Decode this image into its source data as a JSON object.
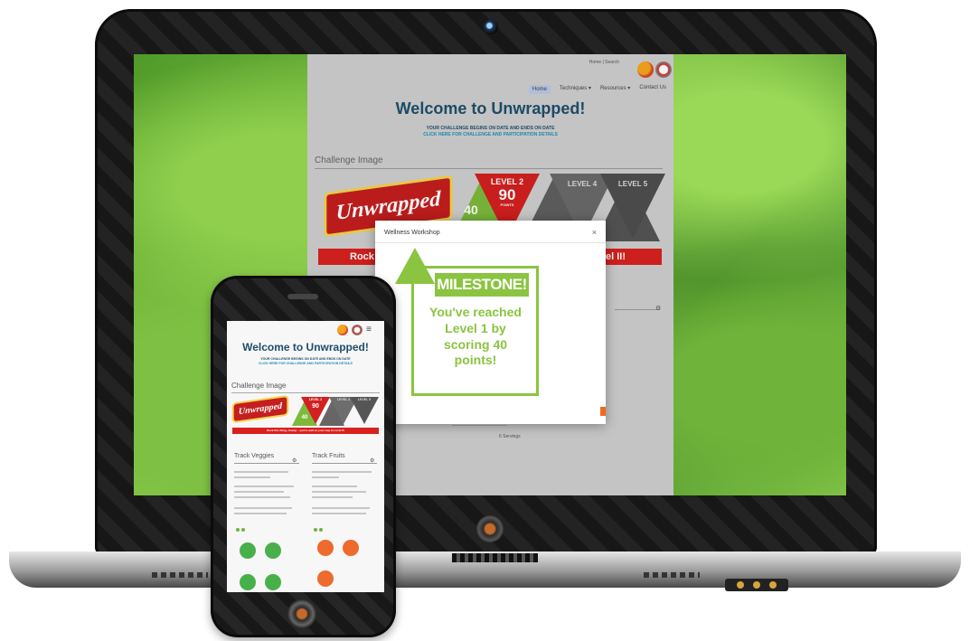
{
  "desktop": {
    "top_links": "Home | Search",
    "nav": [
      {
        "label": "Home"
      },
      {
        "label": "Techniques ▾"
      },
      {
        "label": "Resources ▾"
      },
      {
        "label": "Contact Us"
      }
    ],
    "welcome": "Welcome to Unwrapped!",
    "tagline_1": "YOUR CHALLENGE BEGINS ON DATE AND ENDS ON DATE",
    "tagline_2": "CLICK HERE FOR CHALLENGE AND PARTICIPATION DETAILS",
    "challenge_image_label": "Challenge Image",
    "banner_text": "Unwrapped",
    "levels": [
      {
        "line1": "LEVEL 2",
        "line2": "90",
        "line3": "POINTS"
      },
      {
        "line1": "LEVEL 4",
        "line2": "",
        "line3": ""
      },
      {
        "line1": "LEVEL 5",
        "line2": "",
        "line3": ""
      }
    ],
    "level1_points": "40",
    "redbar_left": "Rock y",
    "redbar_right": "vel II!",
    "footer_hint": "6 Servings"
  },
  "modal": {
    "title": "Wellness Workshop",
    "close": "×",
    "milestone_head": "MILESTONE!",
    "message": "You've reached Level 1 by scoring 40 points!"
  },
  "phone": {
    "welcome": "Welcome to Unwrapped!",
    "tagline_1": "YOUR CHALLENGE BEGINS ON DATE AND ENDS ON DATE",
    "tagline_2": "CLICK HERE FOR CHALLENGE AND PARTICIPATION DETAILS",
    "challenge_image_label": "Challenge Image",
    "banner_text": "Unwrapped",
    "level_labels": [
      "LEVEL 2",
      "LEVEL 4",
      "LEVEL 5"
    ],
    "level2_points": "90",
    "level1_points": "40",
    "redbar": "Rock this thing, champ... you're well on your way to Level II!",
    "track_veggies": "Track Veggies",
    "track_fruits": "Track Fruits"
  },
  "colors": {
    "accent_green": "#8ac440",
    "title_blue": "#1f4e6b",
    "red": "#d8211f"
  }
}
